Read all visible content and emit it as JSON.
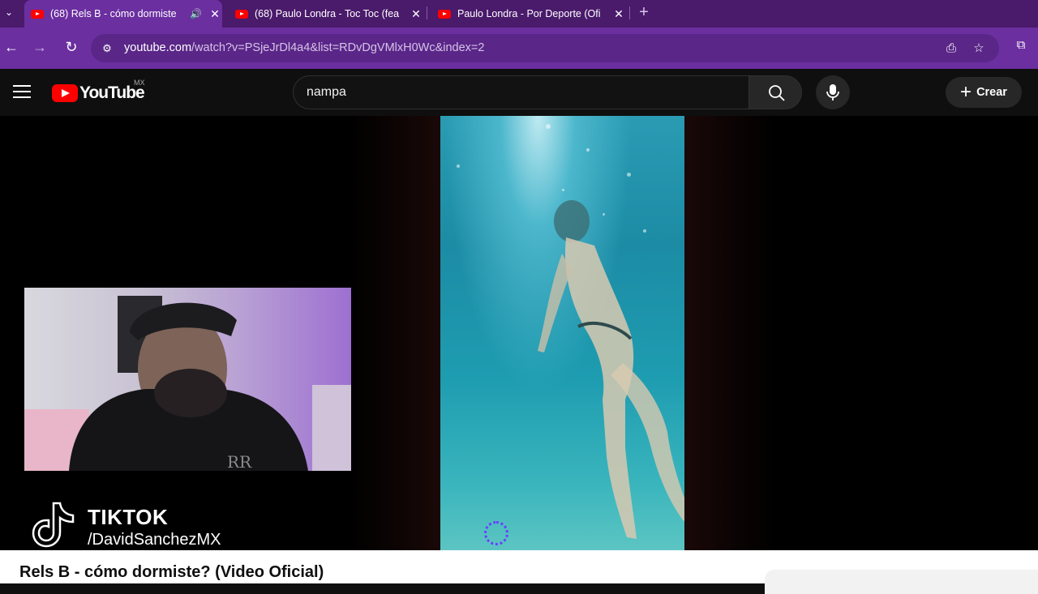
{
  "browser": {
    "tabs": [
      {
        "title": "(68) Rels B - cómo dormiste",
        "active": true,
        "audio": "speaker-icon"
      },
      {
        "title": "(68) Paulo Londra - Toc Toc (fea",
        "active": false
      },
      {
        "title": "Paulo Londra - Por Deporte (Ofi",
        "active": false
      }
    ],
    "new_tab": "+",
    "url_host": "youtube.com",
    "url_path": "/watch?v=PSjeJrDl4a4&list=RDvDgVMlxH0Wc&index=2",
    "accent": "#6b2fa0"
  },
  "youtube": {
    "logo_text": "YouTube",
    "region": "MX",
    "search_value": "nampa",
    "create_label": "Crear"
  },
  "overlay": {
    "brand": "TIKTOK",
    "handle": "/DavidSanchezMX",
    "webcam_watermark": "RR"
  },
  "video": {
    "title": "Rels B - cómo dormiste? (Video Oficial)"
  }
}
